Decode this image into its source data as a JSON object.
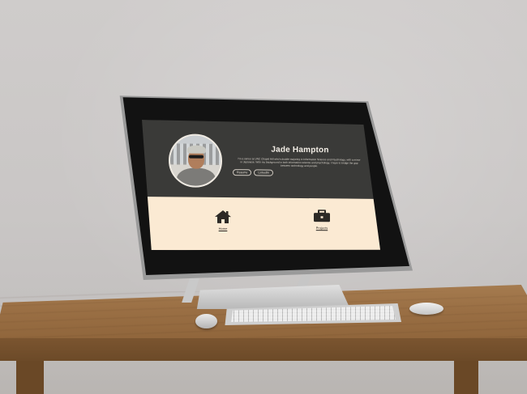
{
  "profile": {
    "name": "Jade Hampton",
    "bio": "I'm a senior at UNC Chapel Hill who's double majoring in Information Science and Psychology, with a minor in Japanese. With my background in both information science and psychology, I hope to bridge the gap between technology and people."
  },
  "links": [
    {
      "label": "Resume"
    },
    {
      "label": "LinkedIn"
    }
  ],
  "nav": {
    "home_label": "Home",
    "home_icon": "house-icon",
    "projects_label": "Projects",
    "projects_icon": "briefcase-icon"
  },
  "colors": {
    "hero_bg": "#3a3a38",
    "nav_bg": "#fbead3",
    "hero_text": "#f3eee6",
    "nav_text": "#2c2925"
  }
}
